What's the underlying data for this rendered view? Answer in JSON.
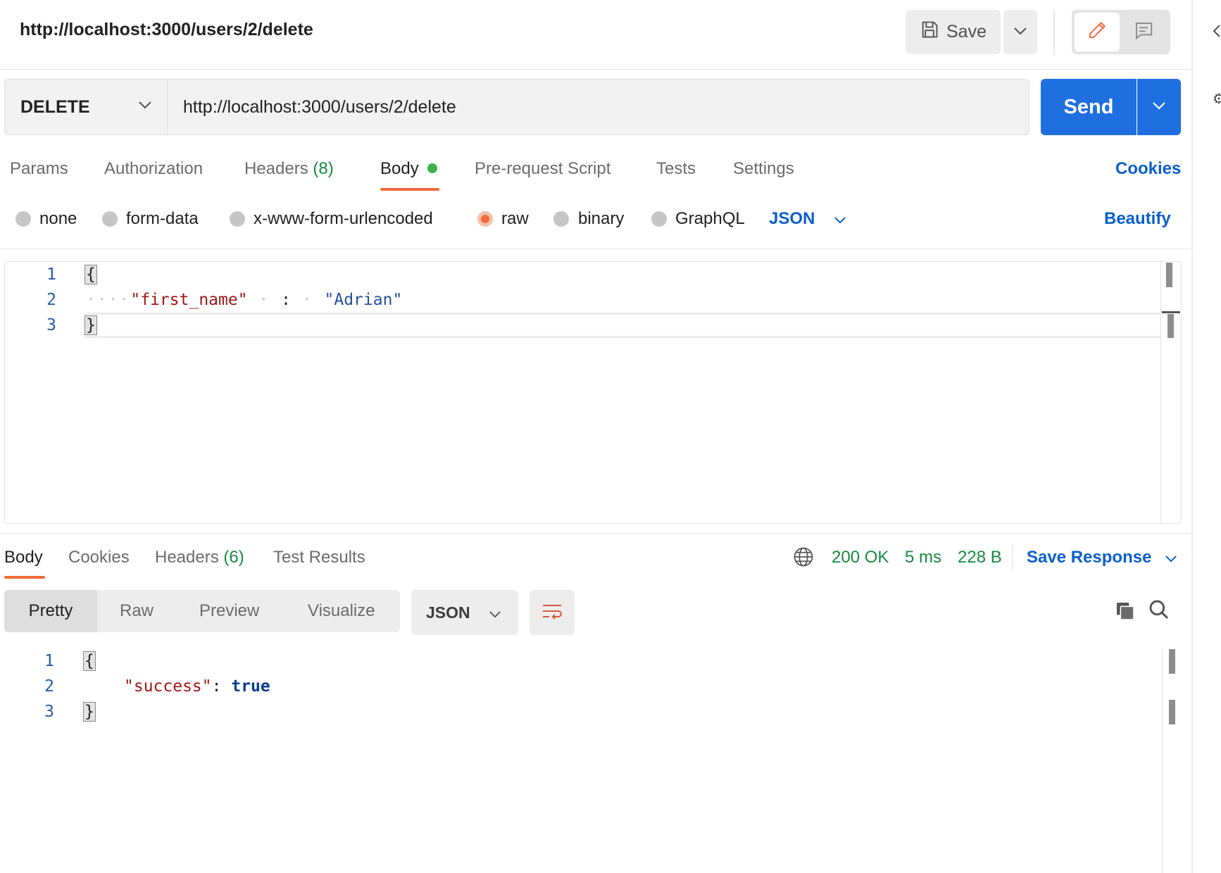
{
  "header": {
    "title": "http://localhost:3000/users/2/delete",
    "save_label": "Save"
  },
  "request": {
    "method": "DELETE",
    "url": "http://localhost:3000/users/2/delete",
    "send_label": "Send"
  },
  "request_tabs": {
    "params": "Params",
    "authorization": "Authorization",
    "headers": "Headers",
    "headers_count": "(8)",
    "body": "Body",
    "pre_request": "Pre-request Script",
    "tests": "Tests",
    "settings": "Settings",
    "cookies": "Cookies",
    "active": "Body"
  },
  "body_types": {
    "none": "none",
    "form_data": "form-data",
    "urlencoded": "x-www-form-urlencoded",
    "raw": "raw",
    "binary": "binary",
    "graphql": "GraphQL",
    "selected": "raw",
    "format": "JSON",
    "beautify": "Beautify"
  },
  "request_body": {
    "line_numbers": [
      "1",
      "2",
      "3"
    ],
    "open_brace": "{",
    "key": "\"first_name\"",
    "colon": ":",
    "value": "\"Adrian\"",
    "close_brace": "}",
    "indent_dots": "····"
  },
  "response_tabs": {
    "body": "Body",
    "cookies": "Cookies",
    "headers": "Headers",
    "headers_count": "(6)",
    "test_results": "Test Results",
    "active": "Body"
  },
  "response_status": {
    "status": "200 OK",
    "time": "5 ms",
    "size": "228 B",
    "save_response": "Save Response"
  },
  "response_view": {
    "pretty": "Pretty",
    "raw": "Raw",
    "preview": "Preview",
    "visualize": "Visualize",
    "selected": "Pretty",
    "format": "JSON"
  },
  "response_body": {
    "line_numbers": [
      "1",
      "2",
      "3"
    ],
    "open_brace": "{",
    "key": "\"success\"",
    "colon": ":",
    "value": "true",
    "close_brace": "}"
  },
  "colors": {
    "accent": "#1f6fe0",
    "link": "#0b5fce",
    "tab_underline": "#f26b3a",
    "status_green": "#168a41"
  }
}
